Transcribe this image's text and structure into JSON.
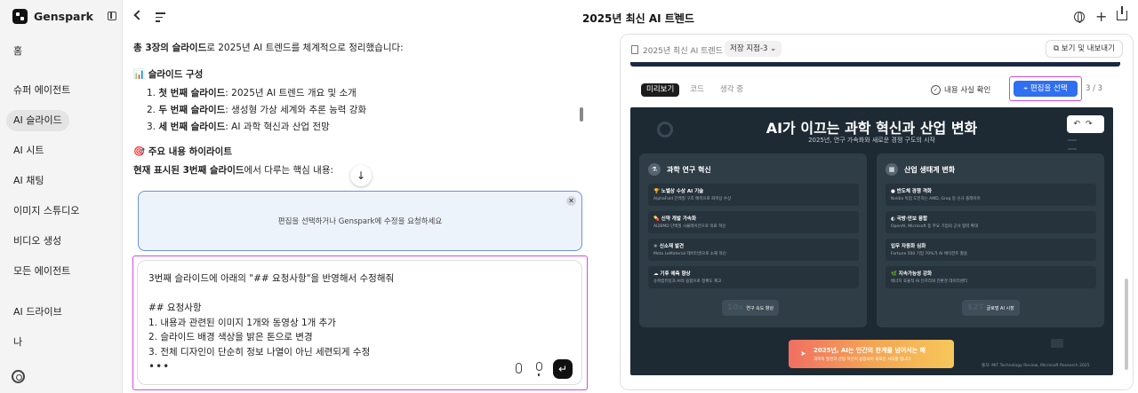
{
  "sidebar": {
    "brand": "Genspark",
    "items": [
      {
        "label": "홈"
      },
      {
        "label": "슈퍼 에이전트"
      },
      {
        "label": "AI 슬라이드",
        "active": true
      },
      {
        "label": "AI 시트"
      },
      {
        "label": "AI 채팅"
      },
      {
        "label": "이미지 스튜디오"
      },
      {
        "label": "비디오 생성"
      },
      {
        "label": "모든 에이전트"
      },
      {
        "label": "AI 드라이브"
      },
      {
        "label": "나"
      }
    ]
  },
  "chat": {
    "intro_bold": "총 3장의 슬라이드",
    "intro_rest": "로 2025년 AI 트렌드를 체계적으로 정리했습니다:",
    "section1": "📊 슬라이드 구성",
    "slides": [
      {
        "bold": "첫 번째 슬라이드",
        "rest": ": 2025년 AI 트렌드 개요 및 소개"
      },
      {
        "bold": "두 번째 슬라이드",
        "rest": ": 생성형 가상 세계와 추론 능력 강화"
      },
      {
        "bold": "세 번째 슬라이드",
        "rest": ": AI 과학 혁신과 산업 전망"
      }
    ],
    "section2": "🎯 주요 내용 하이라이트",
    "current_bold": "현재 표시된 3번째 슬라이드",
    "current_rest": "에서 다루는 핵심 내용:",
    "edit_hint": "편집을 선택하거나 Genspark에 수정을 요청하세요",
    "input_text": "3번째 슬라이드에 아래의 \"## 요청사항\"을 반영해서 수정해줘\n\n## 요청사항\n1. 내용과 관련된 이미지 1개와 동영상 1개 추가\n2. 슬라이드 배경 색상을 밝은 톤으로 변경\n3. 전체 디자인이 단순히 정보 나열이 아닌 세련되게 수정"
  },
  "header": {
    "title": "2025년 최신 AI 트렌드"
  },
  "panel": {
    "doc_title": "2025년 최신 AI 트렌드",
    "version": "저장 지점-3",
    "export_label": "보기 및 내보내기",
    "tabs": [
      "미리보기",
      "코드",
      "생각 중"
    ],
    "fact_check": "내용 사실 확인",
    "select_edit": "편집을 선택",
    "page_counter": "3 / 3"
  },
  "slide": {
    "title": "AI가 이끄는 과학 혁신과 산업 변화",
    "subtitle": "2025년, 연구 가속화와 새로운 경쟁 구도의 시작",
    "left_card": {
      "heading": "과학 연구 혁신",
      "items": [
        {
          "title": "🏆 노벨상 수상 AI 기술",
          "desc": "AlphaFold 단백질 구조 예측으로 화학상 수상"
        },
        {
          "title": "💊 신약 개발 가속화",
          "desc": "AI2BMD 단백질 시뮬레이션으로 의료 혁신"
        },
        {
          "title": "⚛ 신소재 발견",
          "desc": "Meta LeMaterial 데이터셋으로 소재 혁신"
        },
        {
          "title": "☁ 기후 예측 향상",
          "desc": "슈퍼컴퓨팅과 AI의 융합으로 정확도 제고"
        }
      ],
      "stat_value": "10x",
      "stat_label": "연구 속도 향상"
    },
    "right_card": {
      "heading": "산업 생태계 변화",
      "items": [
        {
          "title": "● 반도체 경쟁 격화",
          "desc": "Nvidia 독점 도전하는 AMD, Groq 등 신규 플레이어"
        },
        {
          "title": "◐ 국방·안보 융합",
          "desc": "OpenAI, Microsoft 등 주요 기업의 군사 협력 확대"
        },
        {
          "title": "입무 자동화 심화",
          "desc": "Fortune 500 기업 70%가 AI 에이전트 활용"
        },
        {
          "title": "🌿 지속가능성 강화",
          "desc": "에너지 효율적 AI 인프라와 친환경 데이터센터"
        }
      ],
      "stat_value": "$2T",
      "stat_label": "글로벌 AI 시장"
    },
    "banner_title": "2025년, AI는 인간의 한계를 넘어서는 해",
    "banner_sub": "과학적 발견과 산업 혁신이 융합되어 새로운 시대를 엽니다",
    "source": "출처: MIT Technology Review, Microsoft Research 2025"
  }
}
